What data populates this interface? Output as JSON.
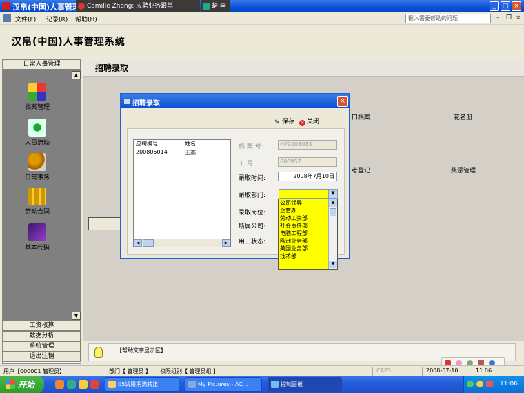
{
  "window": {
    "title": "汉帛(中国)人事管理",
    "overlay_task_1": "Camille Zheng: 应聘业务跟单",
    "overlay_task_2": "楚 李"
  },
  "menu": {
    "items": [
      "文件(F)",
      "记录(R)",
      "帮助(H)"
    ],
    "help_placeholder": "键入需要帮助的问题"
  },
  "header": {
    "title": "汉帛(中国)人事管理系统"
  },
  "sidebar": {
    "top_section": "日常人事管理",
    "items": [
      {
        "label": "档案管理",
        "icon": "cubes-icon"
      },
      {
        "label": "人员流动",
        "icon": "dots-grid-icon"
      },
      {
        "label": "日常事务",
        "icon": "gears-icon"
      },
      {
        "label": "劳动合同",
        "icon": "people-grid-icon"
      },
      {
        "label": "基本代码",
        "icon": "chart-icon"
      }
    ],
    "bottom_sections": [
      "工资核算",
      "数据分析",
      "系统管理",
      "退出注销"
    ]
  },
  "content": {
    "title": "招聘录取",
    "bg_labels": [
      "口档案",
      "花名册",
      "考登记",
      "奖惩管理"
    ]
  },
  "dialog": {
    "title": "招聘录取",
    "save_label": "保存",
    "close_label": "关闭",
    "grid": {
      "columns": [
        "应聘编号",
        "姓名"
      ],
      "rows": [
        [
          "200805014",
          "王燕"
        ]
      ]
    },
    "fields": {
      "archive_no_label": "档 案 号:",
      "archive_no_value": "HP2008033",
      "employee_no_label": "工    号:",
      "employee_no_value": "600957",
      "hire_date_label": "录取时间:",
      "hire_date_value": "2008年7月10日",
      "dept_label": "录取部门:",
      "position_label": "录取岗位:",
      "company_label": "所属公司:",
      "status_label": "用工状态:"
    },
    "dept_options": [
      "公司领导",
      "企管办",
      "劳动工资部",
      "社会责任部",
      "电脑工程部",
      "欧洲业务部",
      "美国业务部",
      "技术部"
    ]
  },
  "helpbar": {
    "text": "【帮助文字显示区】"
  },
  "status": {
    "user": "用户【000001 管理员】",
    "dept": "部门【 管理员 】",
    "group": "权限组别【 管理员组 】",
    "caps": "CAPS",
    "date": "2008-07-10",
    "time": "11:06"
  },
  "taskbar": {
    "start_label": "开始",
    "tasks": [
      "05试用期满转正",
      "My Pictures - AC...",
      "控制面板"
    ],
    "clock": "11:06"
  },
  "colors": {
    "titlebar": "#0a4fd6",
    "dropdown_bg": "#ffff00",
    "taskbar": "#245edc",
    "start": "#2f9a2d"
  }
}
